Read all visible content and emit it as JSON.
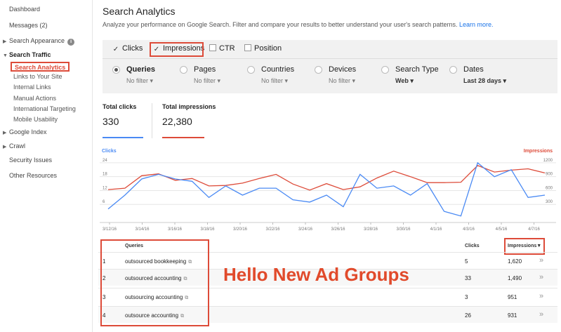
{
  "sidebar": {
    "dashboard": "Dashboard",
    "messages": "Messages (2)",
    "search_appearance": "Search Appearance",
    "search_traffic": "Search Traffic",
    "search_analytics": "Search Analytics",
    "links_to_site": "Links to Your Site",
    "internal_links": "Internal Links",
    "manual_actions": "Manual Actions",
    "international_targeting": "International Targeting",
    "mobile_usability": "Mobile Usability",
    "google_index": "Google Index",
    "crawl": "Crawl",
    "security_issues": "Security Issues",
    "other_resources": "Other Resources"
  },
  "header": {
    "title": "Search Analytics",
    "description": "Analyze your performance on Google Search. Filter and compare your results to better understand your user's search patterns.",
    "learn_more": "Learn more."
  },
  "metrics": {
    "clicks": {
      "label": "Clicks",
      "checked": true
    },
    "impressions": {
      "label": "Impressions",
      "checked": true
    },
    "ctr": {
      "label": "CTR",
      "checked": false
    },
    "position": {
      "label": "Position",
      "checked": false
    },
    "check_glyph": "✓"
  },
  "groups": [
    {
      "label": "Queries",
      "value": "No filter ▾",
      "selected": true
    },
    {
      "label": "Pages",
      "value": "No filter ▾",
      "selected": false
    },
    {
      "label": "Countries",
      "value": "No filter ▾",
      "selected": false
    },
    {
      "label": "Devices",
      "value": "No filter ▾",
      "selected": false
    },
    {
      "label": "Search Type",
      "value": "Web ▾",
      "selected": false
    },
    {
      "label": "Dates",
      "value": "Last 28 days ▾",
      "selected": false
    }
  ],
  "totals": {
    "clicks_label": "Total clicks",
    "clicks_value": "330",
    "impressions_label": "Total impressions",
    "impressions_value": "22,380"
  },
  "colors": {
    "clicks": "#4a8af4",
    "impressions": "#dd4b39",
    "highlight": "#dd4b39"
  },
  "chart_data": {
    "type": "line",
    "x": [
      "3/12/16",
      "3/13/16",
      "3/14/16",
      "3/15/16",
      "3/16/16",
      "3/17/16",
      "3/18/16",
      "3/19/16",
      "3/20/16",
      "3/21/16",
      "3/22/16",
      "3/23/16",
      "3/24/16",
      "3/25/16",
      "3/26/16",
      "3/27/16",
      "3/28/16",
      "3/29/16",
      "3/30/16",
      "3/31/16",
      "4/1/16",
      "4/2/16",
      "4/3/16",
      "4/4/16",
      "4/5/16",
      "4/6/16",
      "4/7/16",
      "4/8/16"
    ],
    "x_tick_labels": [
      "3/12/16",
      "3/14/16",
      "3/16/16",
      "3/18/16",
      "3/20/16",
      "3/22/16",
      "3/24/16",
      "3/26/16",
      "3/28/16",
      "3/30/16",
      "4/1/16",
      "4/3/16",
      "4/5/16",
      "4/7/16"
    ],
    "series": [
      {
        "name": "Clicks",
        "axis": "left",
        "values": [
          4,
          10,
          17,
          19,
          17,
          16,
          9,
          14,
          10,
          13,
          13,
          8,
          7,
          10,
          5,
          19,
          13,
          14,
          10,
          15,
          3,
          1,
          24,
          18,
          21,
          9,
          10
        ]
      },
      {
        "name": "Impressions",
        "axis": "right",
        "values": [
          620,
          650,
          920,
          960,
          820,
          860,
          700,
          710,
          760,
          860,
          950,
          740,
          610,
          750,
          620,
          680,
          870,
          1020,
          900,
          770,
          770,
          780,
          1140,
          1000,
          1040,
          1070,
          980
        ]
      }
    ],
    "left_axis": {
      "title": "Clicks",
      "ticks": [
        6,
        12,
        18,
        24
      ],
      "ylim": [
        0,
        27
      ]
    },
    "right_axis": {
      "title": "Impressions",
      "ticks": [
        300,
        600,
        900,
        1200
      ],
      "ylim": [
        0,
        1350
      ]
    },
    "grid": true
  },
  "table": {
    "headers": {
      "queries": "Queries",
      "clicks": "Clicks",
      "impressions": "Impressions▼"
    },
    "rows": [
      {
        "num": "1",
        "query": "outsourced bookkeeping",
        "clicks": "5",
        "impressions": "1,620"
      },
      {
        "num": "2",
        "query": "outsourced accounting",
        "clicks": "33",
        "impressions": "1,490"
      },
      {
        "num": "3",
        "query": "outsourcing accounting",
        "clicks": "3",
        "impressions": "951"
      },
      {
        "num": "4",
        "query": "outsource accounting",
        "clicks": "26",
        "impressions": "931"
      }
    ],
    "ext_glyph": "⧉",
    "chev_glyph": "»"
  },
  "overlay_text": "Hello New Ad Groups"
}
